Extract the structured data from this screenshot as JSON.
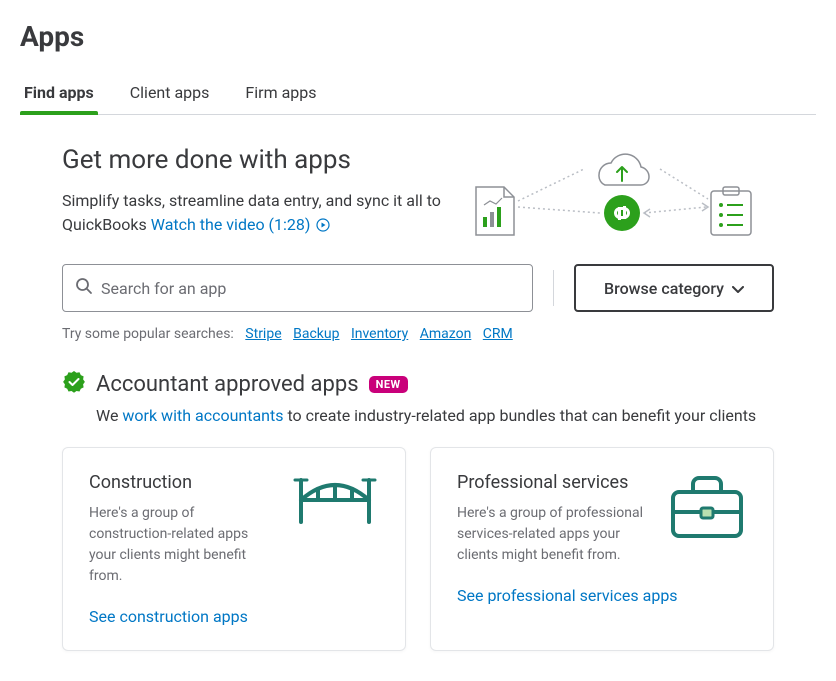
{
  "page": {
    "title": "Apps"
  },
  "tabs": [
    {
      "label": "Find apps",
      "active": true
    },
    {
      "label": "Client apps",
      "active": false
    },
    {
      "label": "Firm apps",
      "active": false
    }
  ],
  "hero": {
    "title": "Get more done with apps",
    "subtitle": "Simplify tasks, streamline data entry, and sync it all to QuickBooks",
    "video_link": "Watch the video (1:28)"
  },
  "search": {
    "placeholder": "Search for an app",
    "browse_label": "Browse category"
  },
  "popular": {
    "label": "Try some popular searches:",
    "items": [
      "Stripe",
      "Backup",
      "Inventory",
      "Amazon",
      "CRM"
    ]
  },
  "approved": {
    "title": "Accountant approved apps",
    "badge": "NEW",
    "sub_prefix": "We ",
    "sub_link": "work with accountants",
    "sub_suffix": " to create industry-related app bundles that can benefit your clients"
  },
  "cards": [
    {
      "title": "Construction",
      "desc": "Here's a group of construction-related apps your clients might benefit from.",
      "link": "See construction apps"
    },
    {
      "title": "Professional services",
      "desc": "Here's a group of professional services-related apps your clients might benefit from.",
      "link": "See professional services apps"
    }
  ]
}
